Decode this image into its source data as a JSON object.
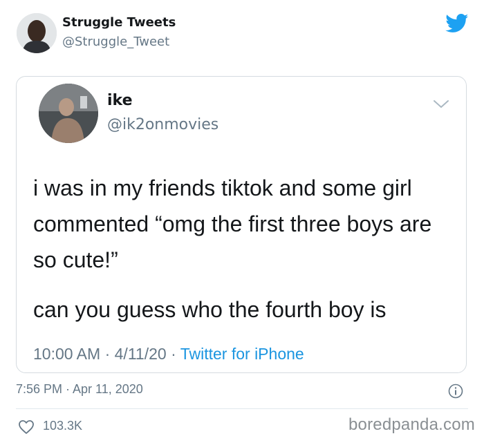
{
  "outer": {
    "name": "Struggle Tweets",
    "handle": "@Struggle_Tweet",
    "timestamp": "7:56 PM · Apr 11, 2020",
    "likes": "103.3K"
  },
  "quoted": {
    "name": "ike",
    "handle": "@ik2onmovies",
    "paragraph1": "i was in my friends tiktok and some girl commented “omg the first three boys are so cute!”",
    "paragraph2": "can you guess who the fourth boy is",
    "time": "10:00 AM",
    "date": "4/11/20",
    "separator": "·",
    "source": "Twitter for iPhone"
  },
  "watermark": "boredpanda.com",
  "colors": {
    "twitter_blue": "#1da1f2",
    "link_blue": "#1b95e0",
    "secondary_text": "#657786",
    "border": "#d5dbe0"
  },
  "icons": [
    "twitter-bird-icon",
    "chevron-down-icon",
    "info-icon",
    "heart-icon"
  ]
}
